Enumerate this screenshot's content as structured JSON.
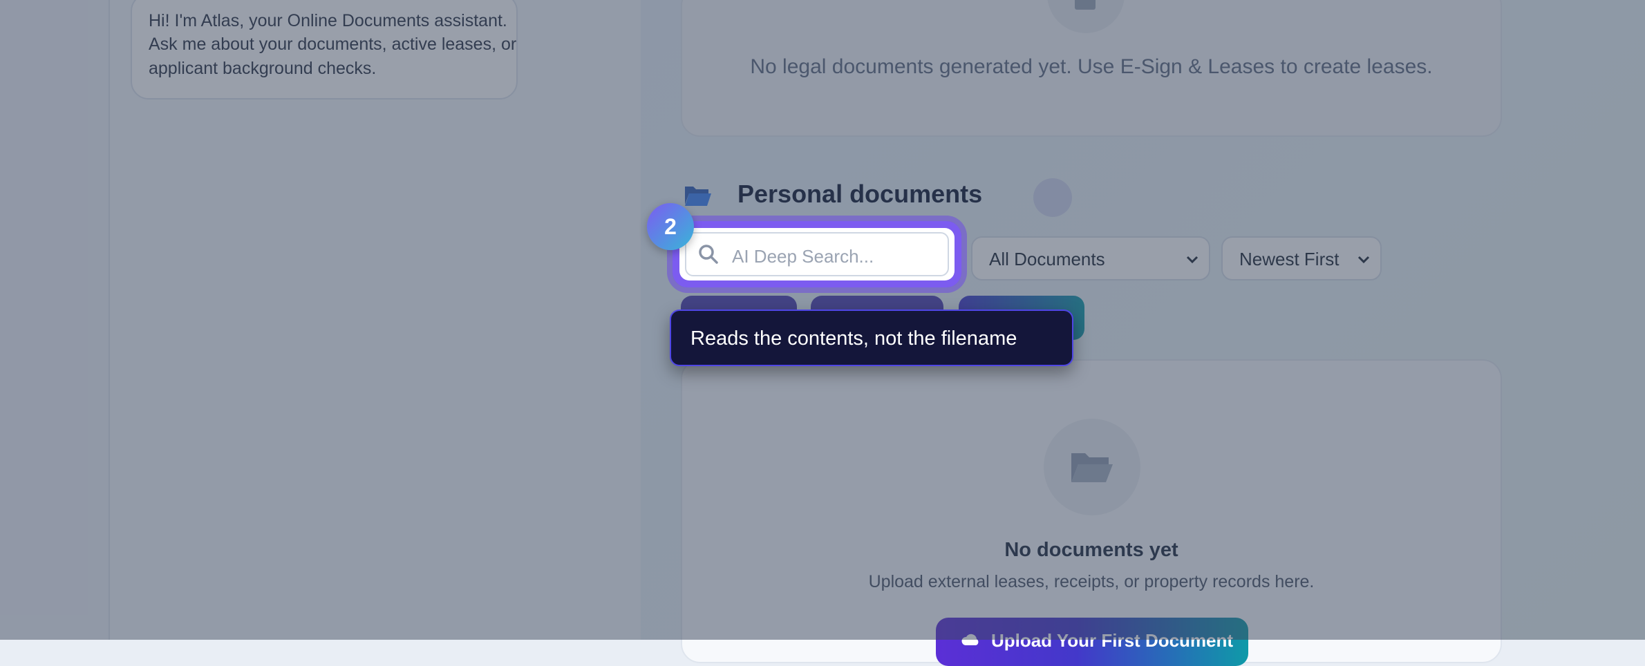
{
  "chat": {
    "message_lines": [
      "Hi! I'm Atlas, your Online Documents assistant.",
      "Ask me about your documents, active leases, or",
      "applicant background checks."
    ]
  },
  "legal_documents": {
    "empty_text": "No legal documents generated yet. Use E-Sign & Leases to create leases.",
    "icon": "document-icon"
  },
  "personal_documents": {
    "title": "Personal documents",
    "icon": "folder-open-icon",
    "search": {
      "placeholder": "AI Deep Search...",
      "value": "",
      "icon": "search-icon"
    },
    "filter_select": {
      "selected": "All Documents"
    },
    "sort_select": {
      "selected": "Newest First"
    },
    "empty_state": {
      "icon": "folder-open-icon",
      "title": "No documents yet",
      "subtitle": "Upload external leases, receipts, or property records here.",
      "upload_button_label": "Upload Your First Document"
    }
  },
  "tour": {
    "step_number": "2",
    "tooltip_text": "Reads the contents, not the filename"
  },
  "colors": {
    "accent": "#7c5cf0",
    "tooltip_bg": "#14163a",
    "title": "#101a36"
  }
}
